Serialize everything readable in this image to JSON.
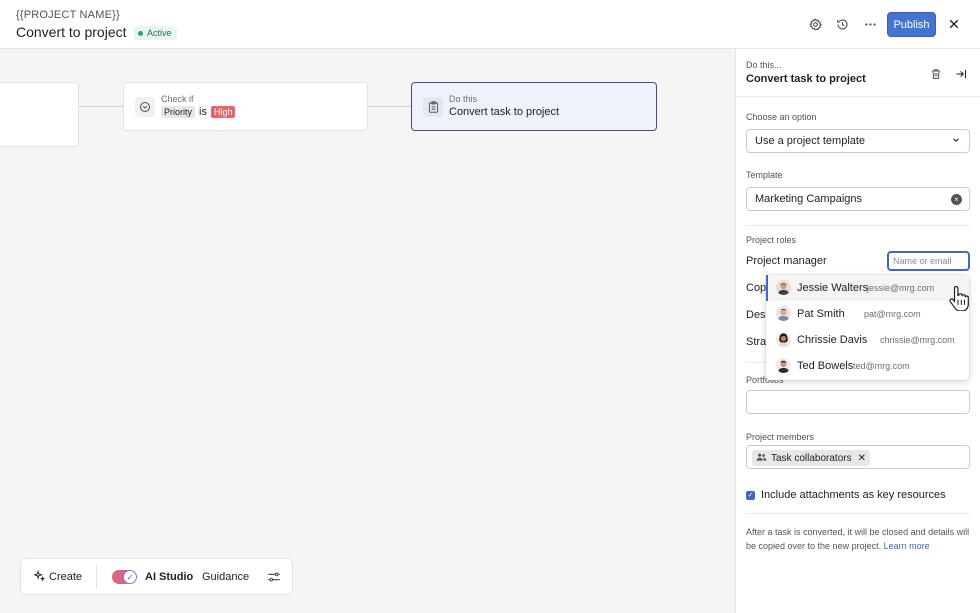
{
  "header": {
    "project_name": "{{PROJECT NAME}}",
    "title": "Convert to project",
    "status": "Active",
    "publish_label": "Publish"
  },
  "canvas": {
    "check_node": {
      "label": "Check if",
      "field": "Priority",
      "op": "is",
      "value": "High"
    },
    "action_node": {
      "label": "Do this",
      "title": "Convert task to project"
    }
  },
  "toolbar": {
    "create": "Create",
    "ai_studio": "AI Studio",
    "guidance": "Guidance"
  },
  "panel": {
    "head_small": "Do this...",
    "head_title": "Convert task to project",
    "option_label": "Choose an option",
    "option_value": "Use a project template",
    "template_label": "Template",
    "template_value": "Marketing Campaigns",
    "roles_label": "Project roles",
    "roles": [
      {
        "name": "Project manager"
      },
      {
        "name": "Copy"
      },
      {
        "name": "Desi"
      },
      {
        "name": "Stra"
      }
    ],
    "role_placeholder": "Name or email",
    "portfolios_label": "Portfolios",
    "members_label": "Project members",
    "members_tag": "Task collaborators",
    "include_label": "Include attachments as key resources",
    "note_text": "After a task is converted, it will be closed and details will be copied over to the new project.",
    "note_link": "Learn more"
  },
  "dropdown": {
    "items": [
      {
        "name": "Jessie Walters",
        "email": "jessie@mrg.com"
      },
      {
        "name": "Pat Smith",
        "email": "pat@mrg.com"
      },
      {
        "name": "Chrissie Davis",
        "email": "chrissie@mrg.com"
      },
      {
        "name": "Ted Bowels",
        "email": "ted@mrg.com"
      }
    ]
  },
  "colors": {
    "accent": "#4573d2",
    "active_green": "#2ea56a",
    "high_red": "#e8646c"
  }
}
